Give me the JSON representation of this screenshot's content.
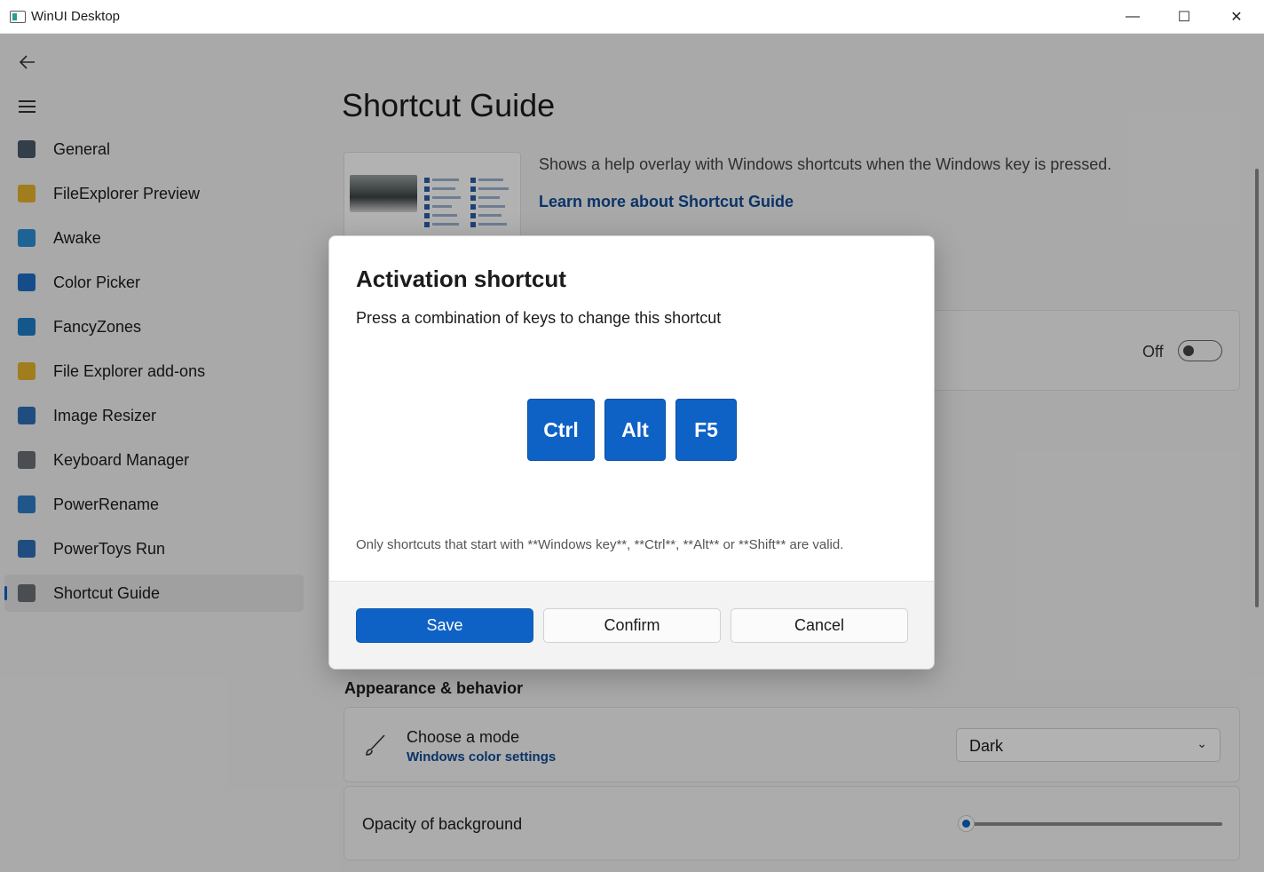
{
  "window": {
    "title": "WinUI Desktop",
    "controls": {
      "minimize": "—",
      "maximize": "☐",
      "close": "✕"
    }
  },
  "nav": {
    "back_icon": "back-arrow-icon",
    "menu_icon": "hamburger-menu-icon",
    "items": [
      {
        "label": "General",
        "icon": "gear-icon",
        "color": "#4a5a6a"
      },
      {
        "label": "FileExplorer Preview",
        "icon": "folder-icon",
        "color": "#e8b32a"
      },
      {
        "label": "Awake",
        "icon": "coffee-cup-icon",
        "color": "#2b8fd6"
      },
      {
        "label": "Color Picker",
        "icon": "color-picker-icon",
        "color": "#1f6fc8"
      },
      {
        "label": "FancyZones",
        "icon": "fancyzones-icon",
        "color": "#1e7fc8"
      },
      {
        "label": "File Explorer add-ons",
        "icon": "folder-icon",
        "color": "#e8b32a"
      },
      {
        "label": "Image Resizer",
        "icon": "image-resizer-icon",
        "color": "#2f6fb8"
      },
      {
        "label": "Keyboard Manager",
        "icon": "keyboard-icon",
        "color": "#6a6f75"
      },
      {
        "label": "PowerRename",
        "icon": "rename-icon",
        "color": "#2e7bc6"
      },
      {
        "label": "PowerToys Run",
        "icon": "run-icon",
        "color": "#2e6fb8"
      },
      {
        "label": "Shortcut Guide",
        "icon": "shortcut-guide-icon",
        "color": "#6a6f75",
        "active": true
      }
    ]
  },
  "page": {
    "title": "Shortcut Guide",
    "description": "Shows a help overlay with Windows shortcuts when the Windows key is pressed.",
    "learn_more": "Learn more about Shortcut Guide",
    "toggle_label": "Off",
    "toggle_on": false,
    "appearance": {
      "heading": "Appearance & behavior",
      "mode_title": "Choose a mode",
      "mode_link": "Windows color settings",
      "mode_value": "Dark",
      "mode_icon": "brush-icon",
      "opacity_title": "Opacity of background",
      "opacity_value_fraction": 0.0
    }
  },
  "dialog": {
    "title": "Activation shortcut",
    "subtitle": "Press a combination of keys to change this shortcut",
    "keys": [
      "Ctrl",
      "Alt",
      "F5"
    ],
    "note": "Only shortcuts that start with **Windows key**, **Ctrl**, **Alt** or **Shift** are valid.",
    "buttons": {
      "save": "Save",
      "confirm": "Confirm",
      "cancel": "Cancel"
    }
  },
  "colors": {
    "accent": "#0f62c5",
    "link": "#0f4a96",
    "background": "#f3f3f3"
  }
}
